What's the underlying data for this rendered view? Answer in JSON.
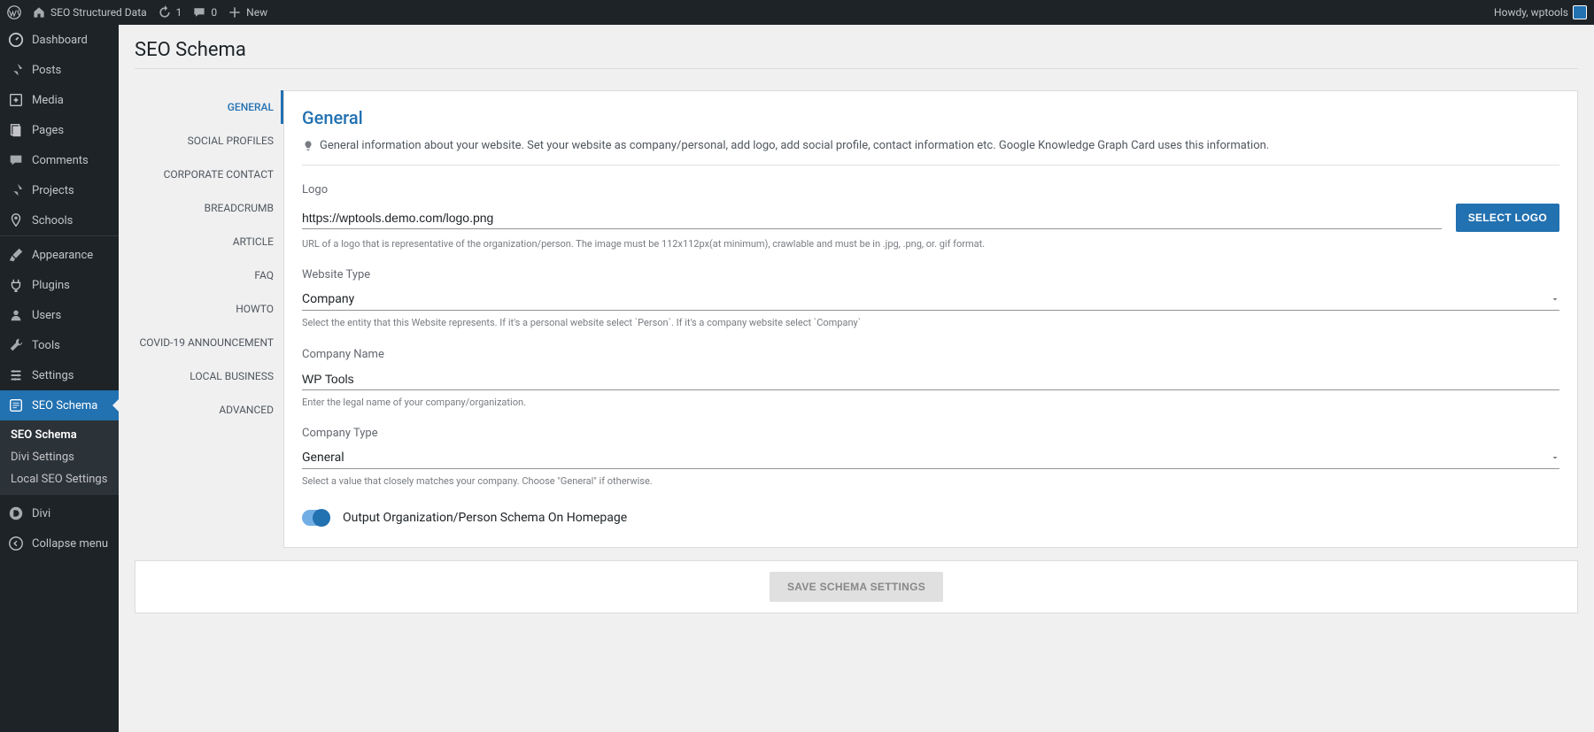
{
  "adminbar": {
    "site_title": "SEO Structured Data",
    "updates": "1",
    "comments": "0",
    "new": "New",
    "greeting": "Howdy, wptools"
  },
  "sidebar": {
    "items": [
      {
        "label": "Dashboard",
        "iconKey": "dashboard"
      },
      {
        "label": "Posts",
        "iconKey": "pin"
      },
      {
        "label": "Media",
        "iconKey": "media"
      },
      {
        "label": "Pages",
        "iconKey": "pages"
      },
      {
        "label": "Comments",
        "iconKey": "comment"
      },
      {
        "label": "Projects",
        "iconKey": "pin"
      },
      {
        "label": "Schools",
        "iconKey": "marker"
      },
      {
        "label": "Appearance",
        "iconKey": "brush"
      },
      {
        "label": "Plugins",
        "iconKey": "plug"
      },
      {
        "label": "Users",
        "iconKey": "user"
      },
      {
        "label": "Tools",
        "iconKey": "wrench"
      },
      {
        "label": "Settings",
        "iconKey": "settings"
      },
      {
        "label": "SEO Schema",
        "iconKey": "schema",
        "active": true
      },
      {
        "label": "Divi",
        "iconKey": "divi"
      },
      {
        "label": "Collapse menu",
        "iconKey": "collapse"
      }
    ],
    "submenu": [
      {
        "label": "SEO Schema",
        "current": true
      },
      {
        "label": "Divi Settings"
      },
      {
        "label": "Local SEO Settings"
      }
    ]
  },
  "page": {
    "title": "SEO Schema"
  },
  "tabs": [
    {
      "label": "GENERAL",
      "active": true
    },
    {
      "label": "SOCIAL PROFILES"
    },
    {
      "label": "CORPORATE CONTACT"
    },
    {
      "label": "BREADCRUMB"
    },
    {
      "label": "ARTICLE"
    },
    {
      "label": "FAQ"
    },
    {
      "label": "HOWTO"
    },
    {
      "label": "COVID-19 ANNOUNCEMENT"
    },
    {
      "label": "LOCAL BUSINESS"
    },
    {
      "label": "ADVANCED"
    }
  ],
  "panel": {
    "title": "General",
    "hint": "General information about your website. Set your website as company/personal, add logo, add social profile, contact information etc. Google Knowledge Graph Card uses this information.",
    "logo": {
      "label": "Logo",
      "value": "https://wptools.demo.com/logo.png",
      "button": "SELECT LOGO",
      "help": "URL of a logo that is representative of the organization/person. The image must be 112x112px(at minimum), crawlable and must be in .jpg, .png, or. gif format."
    },
    "website_type": {
      "label": "Website Type",
      "value": "Company",
      "help": "Select the entity that this Website represents. If it's a personal website select `Person`. If it's a company website select `Company`"
    },
    "company_name": {
      "label": "Company Name",
      "value": "WP Tools",
      "help": "Enter the legal name of your company/organization."
    },
    "company_type": {
      "label": "Company Type",
      "value": "General",
      "help": "Select a value that closely matches your company. Choose \"General\" if otherwise."
    },
    "toggle": {
      "label": "Output Organization/Person Schema On Homepage",
      "on": true
    },
    "save": "SAVE SCHEMA SETTINGS"
  }
}
